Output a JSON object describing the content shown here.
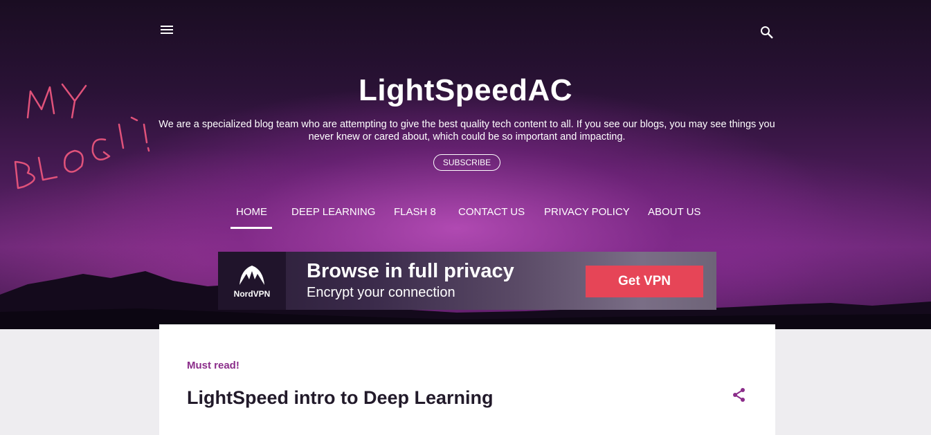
{
  "header": {
    "menu_icon": "menu-icon",
    "search_icon": "search-icon",
    "title": "LightSpeedAC",
    "description": "We are a specialized blog team who are attempting to give the best quality tech content to all. If you see our blogs, you may see things you never knew or cared about, which could be so important and impacting.",
    "subscribe_label": "SUBSCRIBE",
    "scribble_text": "MY BLOG!"
  },
  "nav": {
    "items": [
      {
        "label": "HOME",
        "active": true
      },
      {
        "label": "DEEP LEARNING"
      },
      {
        "label": "FLASH 8"
      },
      {
        "label": "CONTACT US"
      },
      {
        "label": "PRIVACY POLICY"
      },
      {
        "label": "ABOUT US"
      }
    ]
  },
  "ad": {
    "brand": "NordVPN",
    "headline": "Browse in full privacy",
    "subline": "Encrypt your connection",
    "cta": "Get VPN",
    "cta_color": "#e64557"
  },
  "post": {
    "label": "Must read!",
    "title": "LightSpeed intro to Deep Learning",
    "share_icon": "share-icon",
    "accent": "#8b2d8a"
  }
}
